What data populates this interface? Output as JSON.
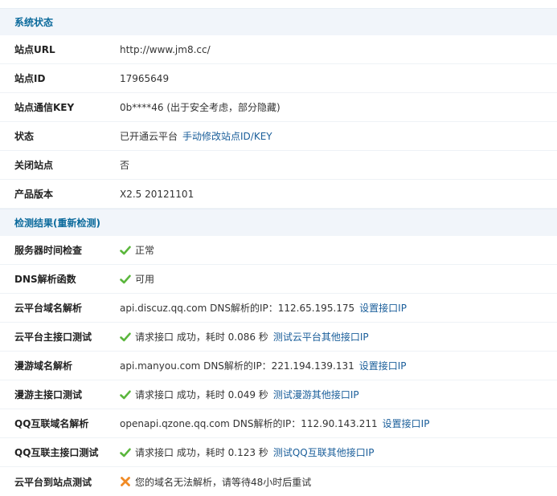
{
  "section_status": {
    "title": "系统状态",
    "rows": [
      {
        "label": "站点URL",
        "value": "http://www.jm8.cc/"
      },
      {
        "label": "站点ID",
        "value": "17965649"
      },
      {
        "label": "站点通信KEY",
        "value": "0b****46 (出于安全考虑，部分隐藏)"
      },
      {
        "label": "状态",
        "value": "已开通云平台",
        "link": "手动修改站点ID/KEY"
      },
      {
        "label": "关闭站点",
        "value": "否"
      },
      {
        "label": "产品版本",
        "value": "X2.5 20121101"
      }
    ]
  },
  "section_check": {
    "title": "检测结果(重新检测)",
    "rows": [
      {
        "label": "服务器时间检查",
        "icon": "check-icon",
        "value": "正常"
      },
      {
        "label": "DNS解析函数",
        "icon": "check-icon",
        "value": "可用"
      },
      {
        "label": "云平台域名解析",
        "value": "api.discuz.qq.com DNS解析的IP：112.65.195.175",
        "link": "设置接口IP"
      },
      {
        "label": "云平台主接口测试",
        "icon": "check-icon",
        "value": "请求接口  成功，耗时  0.086 秒",
        "link": "测试云平台其他接口IP"
      },
      {
        "label": "漫游域名解析",
        "value": "api.manyou.com DNS解析的IP：221.194.139.131",
        "link": "设置接口IP"
      },
      {
        "label": "漫游主接口测试",
        "icon": "check-icon",
        "value": "请求接口  成功，耗时  0.049 秒",
        "link": "测试漫游其他接口IP"
      },
      {
        "label": "QQ互联域名解析",
        "value": "openapi.qzone.qq.com DNS解析的IP：112.90.143.211",
        "link": "设置接口IP"
      },
      {
        "label": "QQ互联主接口测试",
        "icon": "check-icon",
        "value": "请求接口  成功，耗时  0.123 秒",
        "link": "测试QQ互联其他接口IP"
      },
      {
        "label": "云平台到站点测试",
        "icon": "error-icon",
        "value": "您的域名无法解析，请等待48小时后重试"
      }
    ]
  },
  "colors": {
    "ok": "#5ab63c",
    "error": "#f08a24",
    "link": "#1a5e9a",
    "header_bg": "#f1f5fa",
    "header_text": "#0b6a9c"
  }
}
